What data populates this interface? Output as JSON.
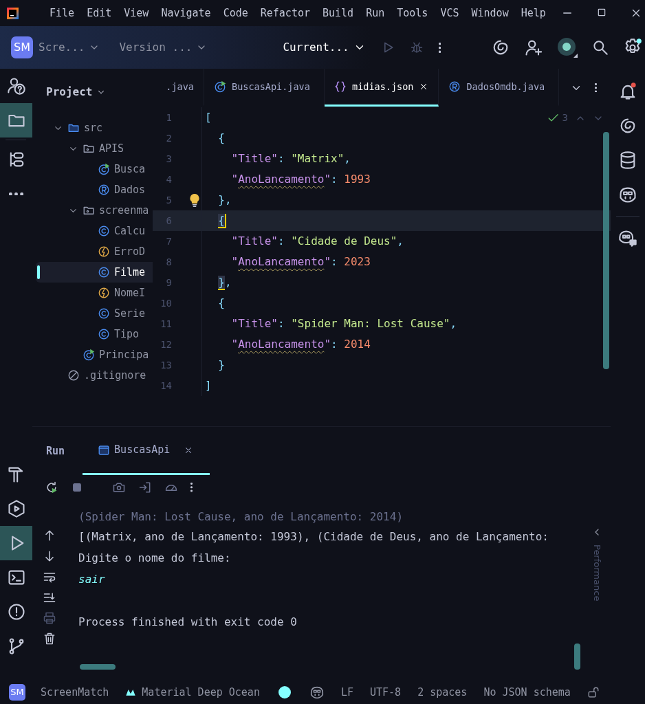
{
  "menu": [
    "File",
    "Edit",
    "View",
    "Navigate",
    "Code",
    "Refactor",
    "Build",
    "Run",
    "Tools",
    "VCS",
    "Window",
    "Help"
  ],
  "toolbar": {
    "project_badge": "SM",
    "project": "Scre...",
    "vcs": "Version ...",
    "run_config": "Current..."
  },
  "left_strip": {
    "top": [
      {
        "kind": "help",
        "selected": false
      },
      {
        "kind": "project",
        "selected": true
      },
      {
        "kind": "structure",
        "selected": false
      },
      {
        "kind": "more",
        "selected": false
      }
    ],
    "bottom": [
      {
        "kind": "build",
        "selected": false
      },
      {
        "kind": "services",
        "selected": false
      },
      {
        "kind": "run",
        "selected": true
      },
      {
        "kind": "terminal",
        "selected": false
      },
      {
        "kind": "problems",
        "selected": false
      },
      {
        "kind": "git",
        "selected": false
      }
    ]
  },
  "right_strip": [
    {
      "kind": "notifications"
    },
    {
      "kind": "swirl"
    },
    {
      "kind": "database"
    },
    {
      "kind": "assistant"
    },
    {
      "kind": "assistant-chat"
    }
  ],
  "project_panel": {
    "title": "Project",
    "tree": [
      {
        "label": "src",
        "kind": "folder",
        "expanded": true,
        "selected": false,
        "children": [
          {
            "label": "APIS",
            "kind": "package",
            "expanded": true,
            "selected": false,
            "children": [
              {
                "label": "Busca",
                "kind": "class-run",
                "selected": false
              },
              {
                "label": "Dados",
                "kind": "record",
                "selected": false
              }
            ]
          },
          {
            "label": "screenma",
            "kind": "package",
            "expanded": true,
            "selected": false,
            "children": [
              {
                "label": "Calcu",
                "kind": "class",
                "selected": false
              },
              {
                "label": "ErroD",
                "kind": "exception",
                "selected": false
              },
              {
                "label": "Filme",
                "kind": "class",
                "selected": true
              },
              {
                "label": "NomeI",
                "kind": "exception",
                "selected": false
              },
              {
                "label": "Serie",
                "kind": "class",
                "selected": false
              },
              {
                "label": "Tipo",
                "kind": "class",
                "selected": false
              }
            ]
          },
          {
            "label": "Principa",
            "kind": "class-run",
            "selected": false
          }
        ]
      },
      {
        "label": ".gitignore",
        "kind": "ignore",
        "selected": false
      }
    ]
  },
  "editor": {
    "tabs": [
      {
        "label": ".java",
        "selected": false
      },
      {
        "label": "BuscasApi.java",
        "kind": "class-run",
        "selected": false
      },
      {
        "label": "midias.json",
        "kind": "json",
        "selected": true
      },
      {
        "label": "DadosOmdb.java",
        "kind": "record",
        "selected": false
      }
    ],
    "inspection_count": "3",
    "lines": [
      {
        "number": "1",
        "kind": "array",
        "current": false,
        "bulb": false,
        "tokens": [
          {
            "kind": "punct",
            "text": "["
          }
        ]
      },
      {
        "number": "2",
        "kind": "object",
        "current": false,
        "bulb": false,
        "tokens": [
          {
            "kind": "punct",
            "text": "{"
          }
        ]
      },
      {
        "number": "3",
        "kind": "property",
        "current": false,
        "bulb": false,
        "tokens": [
          {
            "kind": "key",
            "text": "\"Title\""
          },
          {
            "kind": "punct",
            "text": ": "
          },
          {
            "kind": "string",
            "text": "\"Matrix\""
          },
          {
            "kind": "punct",
            "text": ","
          }
        ]
      },
      {
        "number": "4",
        "kind": "property",
        "current": false,
        "bulb": false,
        "tokens": [
          {
            "kind": "key",
            "text": "\""
          },
          {
            "kind": "key",
            "text": "AnoLancamento",
            "warning": true
          },
          {
            "kind": "key",
            "text": "\""
          },
          {
            "kind": "punct",
            "text": ": "
          },
          {
            "kind": "number",
            "text": "1993"
          }
        ]
      },
      {
        "number": "5",
        "kind": "object",
        "current": false,
        "bulb": true,
        "tokens": [
          {
            "kind": "punct",
            "text": "},"
          }
        ]
      },
      {
        "number": "6",
        "kind": "object",
        "current": true,
        "bulb": false,
        "tokens": [
          {
            "kind": "punct",
            "text": "{",
            "matched": true,
            "caret": true
          }
        ]
      },
      {
        "number": "7",
        "kind": "property",
        "current": false,
        "bulb": false,
        "tokens": [
          {
            "kind": "key",
            "text": "\"Title\""
          },
          {
            "kind": "punct",
            "text": ": "
          },
          {
            "kind": "string",
            "text": "\"Cidade de Deus\""
          },
          {
            "kind": "punct",
            "text": ","
          }
        ]
      },
      {
        "number": "8",
        "kind": "property",
        "current": false,
        "bulb": false,
        "tokens": [
          {
            "kind": "key",
            "text": "\""
          },
          {
            "kind": "key",
            "text": "AnoLancamento",
            "warning": true
          },
          {
            "kind": "key",
            "text": "\""
          },
          {
            "kind": "punct",
            "text": ": "
          },
          {
            "kind": "number",
            "text": "2023"
          }
        ]
      },
      {
        "number": "9",
        "kind": "object",
        "current": false,
        "bulb": false,
        "tokens": [
          {
            "kind": "punct",
            "text": "}",
            "matched": true
          },
          {
            "kind": "punct",
            "text": ","
          }
        ]
      },
      {
        "number": "10",
        "kind": "object",
        "current": false,
        "bulb": false,
        "tokens": [
          {
            "kind": "punct",
            "text": "{"
          }
        ]
      },
      {
        "number": "11",
        "kind": "property",
        "current": false,
        "bulb": false,
        "tokens": [
          {
            "kind": "key",
            "text": "\"Title\""
          },
          {
            "kind": "punct",
            "text": ": "
          },
          {
            "kind": "string",
            "text": "\"Spider Man: Lost Cause\""
          },
          {
            "kind": "punct",
            "text": ","
          }
        ]
      },
      {
        "number": "12",
        "kind": "property",
        "current": false,
        "bulb": false,
        "tokens": [
          {
            "kind": "key",
            "text": "\""
          },
          {
            "kind": "key",
            "text": "AnoLancamento",
            "warning": true
          },
          {
            "kind": "key",
            "text": "\""
          },
          {
            "kind": "punct",
            "text": ": "
          },
          {
            "kind": "number",
            "text": "2014"
          }
        ]
      },
      {
        "number": "13",
        "kind": "object",
        "current": false,
        "bulb": false,
        "tokens": [
          {
            "kind": "punct",
            "text": "}"
          }
        ]
      },
      {
        "number": "14",
        "kind": "array",
        "current": false,
        "bulb": false,
        "tokens": [
          {
            "kind": "punct",
            "text": "]"
          }
        ]
      }
    ]
  },
  "run_panel": {
    "title": "Run",
    "tabs": [
      {
        "label": "BuscasApi",
        "selected": true
      }
    ],
    "console": [
      {
        "kind": "output",
        "text": "(Spider Man: Lost Cause, ano de Lançamento: 2014)"
      },
      {
        "kind": "output",
        "text": "[(Matrix, ano de Lançamento: 1993), (Cidade de Deus, ano de Lançamento:"
      },
      {
        "kind": "output",
        "text": "Digite o nome do filme:"
      },
      {
        "kind": "input",
        "text": "sair"
      },
      {
        "kind": "exit",
        "text": "Process finished with exit code 0"
      }
    ],
    "side_label": "Performance"
  },
  "status_bar": {
    "project_badge": "SM",
    "project": "ScreenMatch",
    "theme": "Material Deep Ocean",
    "line_separator": "LF",
    "encoding": "UTF-8",
    "indent": "2 spaces",
    "schema": "No JSON schema"
  }
}
